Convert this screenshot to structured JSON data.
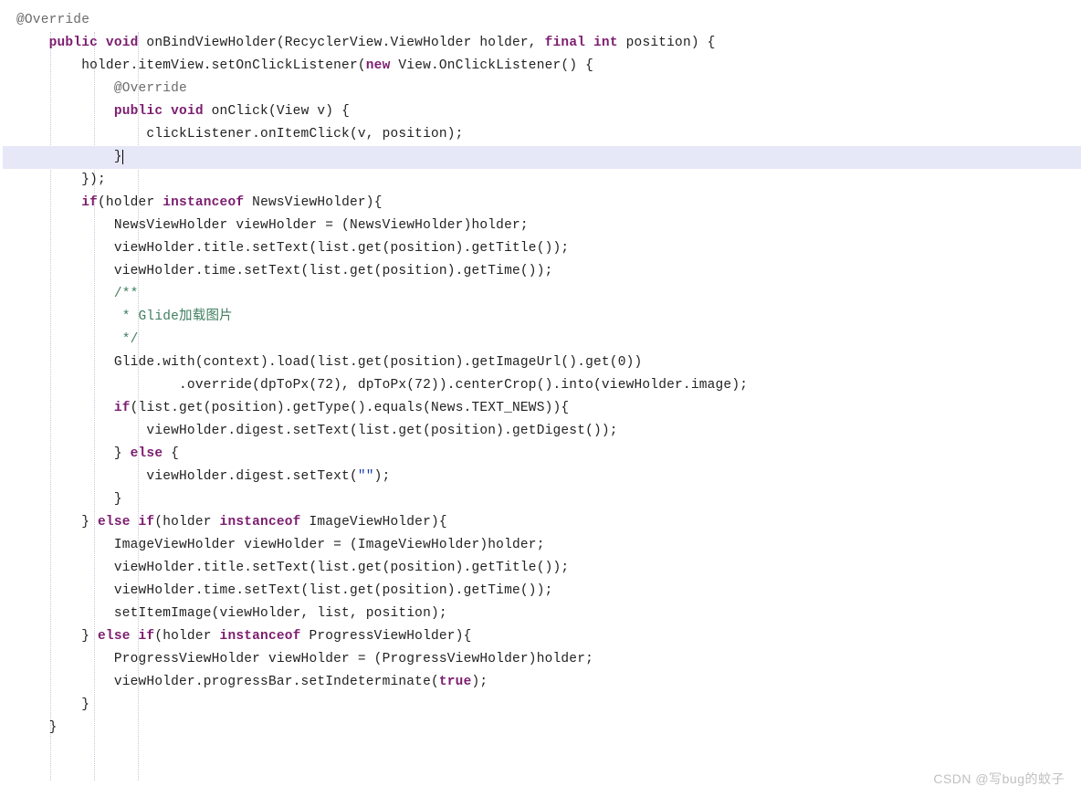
{
  "lines": [
    {
      "indent": 0,
      "hl": false,
      "text": "@Override",
      "cls": "ann"
    },
    {
      "indent": 1,
      "hl": false,
      "segments": [
        [
          "kw",
          "public void"
        ],
        [
          "plain",
          " onBindViewHolder(RecyclerView.ViewHolder holder, "
        ],
        [
          "kw",
          "final int"
        ],
        [
          "plain",
          " position) {"
        ]
      ]
    },
    {
      "indent": 2,
      "hl": false,
      "segments": [
        [
          "plain",
          "holder.itemView.setOnClickListener("
        ],
        [
          "kw",
          "new"
        ],
        [
          "plain",
          " View.OnClickListener() {"
        ]
      ]
    },
    {
      "indent": 3,
      "hl": false,
      "text": "@Override",
      "cls": "ann"
    },
    {
      "indent": 3,
      "hl": false,
      "segments": [
        [
          "kw",
          "public void"
        ],
        [
          "plain",
          " onClick(View v) {"
        ]
      ]
    },
    {
      "indent": 4,
      "hl": false,
      "text": "clickListener.onItemClick(v, position);"
    },
    {
      "indent": 3,
      "hl": true,
      "text": "}",
      "caret": true
    },
    {
      "indent": 2,
      "hl": false,
      "text": "});"
    },
    {
      "indent": 2,
      "hl": false,
      "segments": [
        [
          "kw",
          "if"
        ],
        [
          "plain",
          "(holder "
        ],
        [
          "kw",
          "instanceof"
        ],
        [
          "plain",
          " NewsViewHolder){"
        ]
      ]
    },
    {
      "indent": 3,
      "hl": false,
      "text": "NewsViewHolder viewHolder = (NewsViewHolder)holder;"
    },
    {
      "indent": 3,
      "hl": false,
      "text": "viewHolder.title.setText(list.get(position).getTitle());"
    },
    {
      "indent": 3,
      "hl": false,
      "text": "viewHolder.time.setText(list.get(position).getTime());"
    },
    {
      "indent": 3,
      "hl": false,
      "text": "/**",
      "cls": "comment"
    },
    {
      "indent": 3,
      "hl": false,
      "text": " * Glide加载图片",
      "cls": "comment"
    },
    {
      "indent": 3,
      "hl": false,
      "text": " */",
      "cls": "comment"
    },
    {
      "indent": 3,
      "hl": false,
      "text": "Glide.with(context).load(list.get(position).getImageUrl().get(0))"
    },
    {
      "indent": 5,
      "hl": false,
      "text": ".override(dpToPx(72), dpToPx(72)).centerCrop().into(viewHolder.image);"
    },
    {
      "indent": 3,
      "hl": false,
      "segments": [
        [
          "kw",
          "if"
        ],
        [
          "plain",
          "(list.get(position).getType().equals(News.TEXT_NEWS)){"
        ]
      ]
    },
    {
      "indent": 4,
      "hl": false,
      "text": "viewHolder.digest.setText(list.get(position).getDigest());"
    },
    {
      "indent": 3,
      "hl": false,
      "segments": [
        [
          "plain",
          "} "
        ],
        [
          "kw",
          "else"
        ],
        [
          "plain",
          " {"
        ]
      ]
    },
    {
      "indent": 4,
      "hl": false,
      "segments": [
        [
          "plain",
          "viewHolder.digest.setText("
        ],
        [
          "str",
          "\"\""
        ],
        [
          "plain",
          ");"
        ]
      ]
    },
    {
      "indent": 3,
      "hl": false,
      "text": "}"
    },
    {
      "indent": 2,
      "hl": false,
      "segments": [
        [
          "plain",
          "} "
        ],
        [
          "kw",
          "else if"
        ],
        [
          "plain",
          "(holder "
        ],
        [
          "kw",
          "instanceof"
        ],
        [
          "plain",
          " ImageViewHolder){"
        ]
      ]
    },
    {
      "indent": 3,
      "hl": false,
      "text": "ImageViewHolder viewHolder = (ImageViewHolder)holder;"
    },
    {
      "indent": 3,
      "hl": false,
      "text": "viewHolder.title.setText(list.get(position).getTitle());"
    },
    {
      "indent": 3,
      "hl": false,
      "text": "viewHolder.time.setText(list.get(position).getTime());"
    },
    {
      "indent": 3,
      "hl": false,
      "text": "setItemImage(viewHolder, list, position);"
    },
    {
      "indent": 2,
      "hl": false,
      "segments": [
        [
          "plain",
          "} "
        ],
        [
          "kw",
          "else if"
        ],
        [
          "plain",
          "(holder "
        ],
        [
          "kw",
          "instanceof"
        ],
        [
          "plain",
          " ProgressViewHolder){"
        ]
      ]
    },
    {
      "indent": 3,
      "hl": false,
      "text": "ProgressViewHolder viewHolder = (ProgressViewHolder)holder;"
    },
    {
      "indent": 3,
      "hl": false,
      "segments": [
        [
          "plain",
          "viewHolder.progressBar.setIndeterminate("
        ],
        [
          "kw",
          "true"
        ],
        [
          "plain",
          ");"
        ]
      ]
    },
    {
      "indent": 0,
      "hl": false,
      "text": ""
    },
    {
      "indent": 2,
      "hl": false,
      "text": "}"
    },
    {
      "indent": 1,
      "hl": false,
      "text": "}"
    }
  ],
  "watermark": "CSDN @写bug的蚊子"
}
